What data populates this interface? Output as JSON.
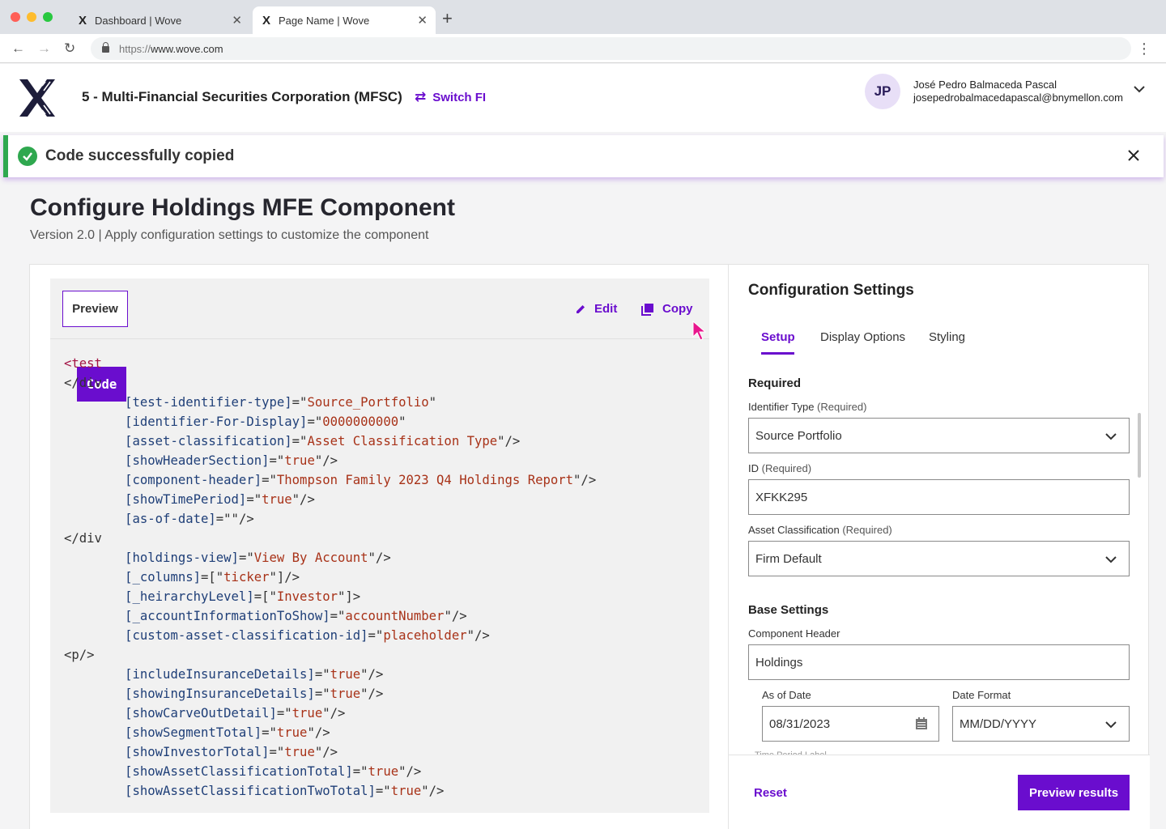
{
  "browser": {
    "tabs": [
      {
        "title": "Dashboard | Wove",
        "logo": "X"
      },
      {
        "title": "Page Name | Wove",
        "logo": "X"
      }
    ],
    "url_scheme": "https://",
    "url_host": "www.wove.com",
    "traffic_colors": [
      "#ff5f57",
      "#febc2e",
      "#28c840"
    ]
  },
  "header": {
    "fi_name": "5 - Multi-Financial Securities Corporation (MFSC)",
    "switch_label": "Switch FI",
    "user": {
      "initials": "JP",
      "name": "José Pedro Balmaceda Pascal",
      "email": "josepedrobalmacedapascal@bnymellon.com"
    }
  },
  "toast": {
    "message": "Code successfully copied",
    "color": "#2fa84f"
  },
  "page": {
    "title": "Configure Holdings MFE Component",
    "subtitle": "Version 2.0 | Apply configuration settings to customize the component"
  },
  "left": {
    "tabs": {
      "preview": "Preview",
      "code": "Code"
    },
    "edit_label": "Edit",
    "copy_label": "Copy",
    "code_lines": [
      [
        {
          "t": "tag",
          "v": "<test"
        }
      ],
      [
        {
          "t": "plain",
          "v": "</div"
        }
      ],
      [
        {
          "t": "plain",
          "v": "        "
        },
        {
          "t": "attr",
          "v": "[test-identifier-type]"
        },
        {
          "t": "plain",
          "v": "=\""
        },
        {
          "t": "str",
          "v": "Source_Portfolio"
        },
        {
          "t": "plain",
          "v": "\""
        }
      ],
      [
        {
          "t": "plain",
          "v": "        "
        },
        {
          "t": "attr",
          "v": "[identifier-For-Display]"
        },
        {
          "t": "plain",
          "v": "=\""
        },
        {
          "t": "str",
          "v": "0000000000"
        },
        {
          "t": "plain",
          "v": "\""
        }
      ],
      [
        {
          "t": "plain",
          "v": "        "
        },
        {
          "t": "attr",
          "v": "[asset-classification]"
        },
        {
          "t": "plain",
          "v": "=\""
        },
        {
          "t": "str",
          "v": "Asset Classification Type"
        },
        {
          "t": "plain",
          "v": "\"/>"
        }
      ],
      [
        {
          "t": "plain",
          "v": "        "
        },
        {
          "t": "attr",
          "v": "[showHeaderSection]"
        },
        {
          "t": "plain",
          "v": "=\""
        },
        {
          "t": "str",
          "v": "true"
        },
        {
          "t": "plain",
          "v": "\"/>"
        }
      ],
      [
        {
          "t": "plain",
          "v": "        "
        },
        {
          "t": "attr",
          "v": "[component-header]"
        },
        {
          "t": "plain",
          "v": "=\""
        },
        {
          "t": "str",
          "v": "Thompson Family 2023 Q4 Holdings Report"
        },
        {
          "t": "plain",
          "v": "\"/>"
        }
      ],
      [
        {
          "t": "plain",
          "v": "        "
        },
        {
          "t": "attr",
          "v": "[showTimePeriod]"
        },
        {
          "t": "plain",
          "v": "=\""
        },
        {
          "t": "str",
          "v": "true"
        },
        {
          "t": "plain",
          "v": "\"/>"
        }
      ],
      [
        {
          "t": "plain",
          "v": "        "
        },
        {
          "t": "attr",
          "v": "[as-of-date]"
        },
        {
          "t": "plain",
          "v": "=\"\"/>"
        }
      ],
      [
        {
          "t": "plain",
          "v": "</div"
        }
      ],
      [
        {
          "t": "plain",
          "v": "        "
        },
        {
          "t": "attr",
          "v": "[holdings-view]"
        },
        {
          "t": "plain",
          "v": "=\""
        },
        {
          "t": "str",
          "v": "View By Account"
        },
        {
          "t": "plain",
          "v": "\"/>"
        }
      ],
      [
        {
          "t": "plain",
          "v": "        "
        },
        {
          "t": "attr",
          "v": "[_columns]"
        },
        {
          "t": "plain",
          "v": "=[\""
        },
        {
          "t": "str",
          "v": "ticker"
        },
        {
          "t": "plain",
          "v": "\"]/>"
        }
      ],
      [
        {
          "t": "plain",
          "v": "        "
        },
        {
          "t": "attr",
          "v": "[_heirarchyLevel]"
        },
        {
          "t": "plain",
          "v": "=[\""
        },
        {
          "t": "str",
          "v": "Investor"
        },
        {
          "t": "plain",
          "v": "\"]>"
        }
      ],
      [
        {
          "t": "plain",
          "v": "        "
        },
        {
          "t": "attr",
          "v": "[_accountInformationToShow]"
        },
        {
          "t": "plain",
          "v": "=\""
        },
        {
          "t": "str",
          "v": "accountNumber"
        },
        {
          "t": "plain",
          "v": "\"/>"
        }
      ],
      [
        {
          "t": "plain",
          "v": "        "
        },
        {
          "t": "attr",
          "v": "[custom-asset-classification-id]"
        },
        {
          "t": "plain",
          "v": "=\""
        },
        {
          "t": "str",
          "v": "placeholder"
        },
        {
          "t": "plain",
          "v": "\"/>"
        }
      ],
      [
        {
          "t": "plain",
          "v": "<p/>"
        }
      ],
      [
        {
          "t": "plain",
          "v": "        "
        },
        {
          "t": "attr",
          "v": "[includeInsuranceDetails]"
        },
        {
          "t": "plain",
          "v": "=\""
        },
        {
          "t": "str",
          "v": "true"
        },
        {
          "t": "plain",
          "v": "\"/>"
        }
      ],
      [
        {
          "t": "plain",
          "v": "        "
        },
        {
          "t": "attr",
          "v": "[showingInsuranceDetails]"
        },
        {
          "t": "plain",
          "v": "=\""
        },
        {
          "t": "str",
          "v": "true"
        },
        {
          "t": "plain",
          "v": "\"/>"
        }
      ],
      [
        {
          "t": "plain",
          "v": "        "
        },
        {
          "t": "attr",
          "v": "[showCarveOutDetail]"
        },
        {
          "t": "plain",
          "v": "=\""
        },
        {
          "t": "str",
          "v": "true"
        },
        {
          "t": "plain",
          "v": "\"/>"
        }
      ],
      [
        {
          "t": "plain",
          "v": "        "
        },
        {
          "t": "attr",
          "v": "[showSegmentTotal]"
        },
        {
          "t": "plain",
          "v": "=\""
        },
        {
          "t": "str",
          "v": "true"
        },
        {
          "t": "plain",
          "v": "\"/>"
        }
      ],
      [
        {
          "t": "plain",
          "v": "        "
        },
        {
          "t": "attr",
          "v": "[showInvestorTotal]"
        },
        {
          "t": "plain",
          "v": "=\""
        },
        {
          "t": "str",
          "v": "true"
        },
        {
          "t": "plain",
          "v": "\"/>"
        }
      ],
      [
        {
          "t": "plain",
          "v": "        "
        },
        {
          "t": "attr",
          "v": "[showAssetClassificationTotal]"
        },
        {
          "t": "plain",
          "v": "=\""
        },
        {
          "t": "str",
          "v": "true"
        },
        {
          "t": "plain",
          "v": "\"/>"
        }
      ],
      [
        {
          "t": "plain",
          "v": "        "
        },
        {
          "t": "attr",
          "v": "[showAssetClassificationTwoTotal]"
        },
        {
          "t": "plain",
          "v": "=\""
        },
        {
          "t": "str",
          "v": "true"
        },
        {
          "t": "plain",
          "v": "\"/>"
        }
      ]
    ]
  },
  "right": {
    "title": "Configuration Settings",
    "tabs": [
      "Setup",
      "Display Options",
      "Styling"
    ],
    "required_heading": "Required",
    "fields": {
      "identifier_type": {
        "label": "Identifier Type",
        "req": "(Required)",
        "value": "Source Portfolio"
      },
      "id": {
        "label": "ID",
        "req": "(Required)",
        "value": "XFKK295"
      },
      "asset_classification": {
        "label": "Asset Classification",
        "req": "(Required)",
        "value": "Firm Default"
      }
    },
    "base_heading": "Base Settings",
    "component_header": {
      "label": "Component Header",
      "value": "Holdings"
    },
    "as_of_date": {
      "label": "As of Date",
      "value": "08/31/2023"
    },
    "date_format": {
      "label": "Date Format",
      "value": "MM/DD/YYYY"
    },
    "clipped_label": "Time Period Label",
    "reset_label": "Reset",
    "preview_label": "Preview results"
  },
  "colors": {
    "accent": "#6a0dce",
    "success": "#2fa84f"
  }
}
